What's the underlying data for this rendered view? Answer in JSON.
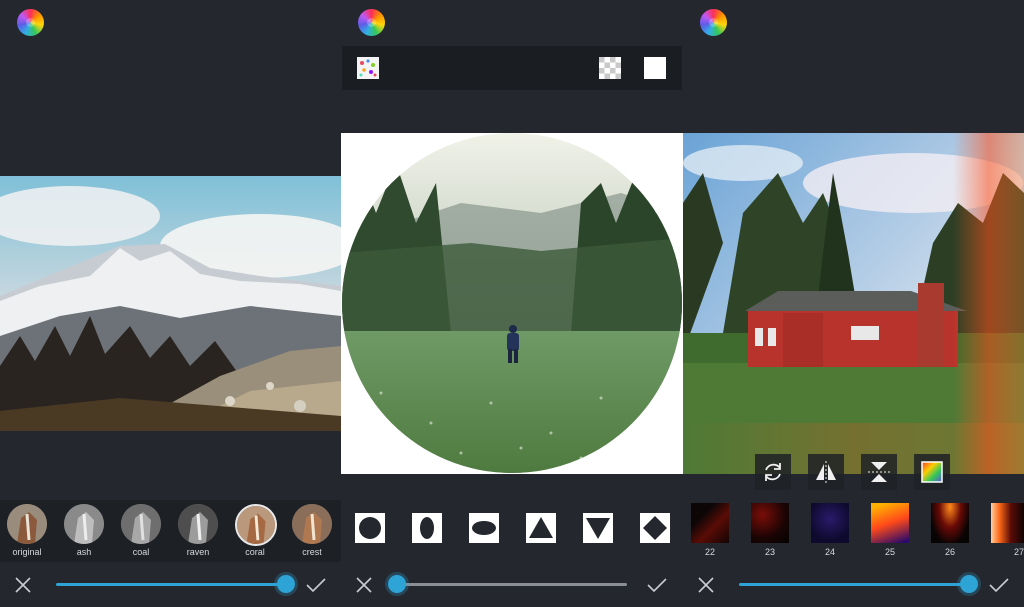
{
  "panel_filters": {
    "logo_icon": "rainbow-logo-icon",
    "filters": [
      {
        "label": "original"
      },
      {
        "label": "ash"
      },
      {
        "label": "coal"
      },
      {
        "label": "raven"
      },
      {
        "label": "coral",
        "selected": true
      },
      {
        "label": "crest"
      }
    ],
    "slider_value": 1.0,
    "cancel_icon": "close-icon",
    "confirm_icon": "check-icon"
  },
  "panel_shapes": {
    "logo_icon": "rainbow-logo-icon",
    "toolbar_icons": [
      "pattern-background-icon",
      "transparent-background-icon",
      "white-background-icon"
    ],
    "shapes": [
      "rounded-square",
      "ellipse-vertical",
      "ellipse-horizontal",
      "triangle-up",
      "triangle-down",
      "diamond"
    ],
    "slider_value": 0.0,
    "cancel_icon": "close-icon",
    "confirm_icon": "check-icon"
  },
  "panel_overlays": {
    "logo_icon": "rainbow-logo-icon",
    "tools": [
      "rotate-icon",
      "flip-horizontal-icon",
      "flip-vertical-icon",
      "color-palette-icon"
    ],
    "textures": [
      {
        "label": "22"
      },
      {
        "label": "23"
      },
      {
        "label": "24"
      },
      {
        "label": "25"
      },
      {
        "label": "26"
      },
      {
        "label": "27"
      }
    ],
    "slider_value": 1.0,
    "cancel_icon": "close-icon",
    "confirm_icon": "check-icon"
  },
  "colors": {
    "background": "#24282e",
    "accent": "#2ea3d6",
    "track": "#8a8f95"
  }
}
